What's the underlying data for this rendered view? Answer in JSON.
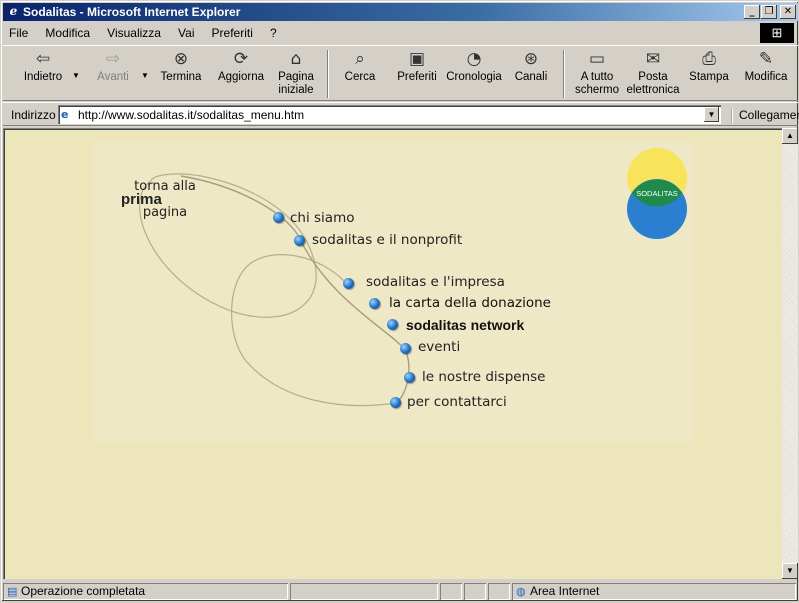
{
  "window": {
    "title": "Sodalitas - Microsoft Internet Explorer",
    "controls": [
      "_",
      "❐",
      "✕"
    ]
  },
  "menu": [
    "File",
    "Modifica",
    "Visualizza",
    "Vai",
    "Preferiti",
    "?"
  ],
  "toolbar": {
    "indietro": "Indietro",
    "avanti": "Avanti",
    "termina": "Termina",
    "aggiorna": "Aggiorna",
    "pagina_iniziale_1": "Pagina",
    "pagina_iniziale_2": "iniziale",
    "cerca": "Cerca",
    "preferiti": "Preferiti",
    "cronologia": "Cronologia",
    "canali": "Canali",
    "a_tutto_schermo_1": "A tutto",
    "a_tutto_schermo_2": "schermo",
    "posta_1": "Posta",
    "posta_2": "elettronica",
    "stampa": "Stampa",
    "modifica": "Modifica"
  },
  "address": {
    "label": "Indirizzo",
    "url": "http://www.sodalitas.it/sodalitas_menu.htm",
    "links": "Collegamenti"
  },
  "page": {
    "home_link": {
      "line1": "torna alla",
      "line2": "prima",
      "line3": "pagina"
    },
    "logo_text": "SODALITAS",
    "menu": [
      "chi siamo",
      "sodalitas e il nonprofit",
      "sodalitas e l'impresa",
      "la carta della donazione",
      "sodalitas network",
      "eventi",
      "le nostre dispense",
      "per contattarci"
    ]
  },
  "status": {
    "text": "Operazione completata",
    "zone": "Area Internet"
  },
  "colors": {
    "page_bg": "#ede6ba",
    "dot": "#1f6fc0",
    "logo_yellow": "#f7e45a",
    "logo_green": "#1f8a4c",
    "logo_blue": "#2a7fd0"
  }
}
